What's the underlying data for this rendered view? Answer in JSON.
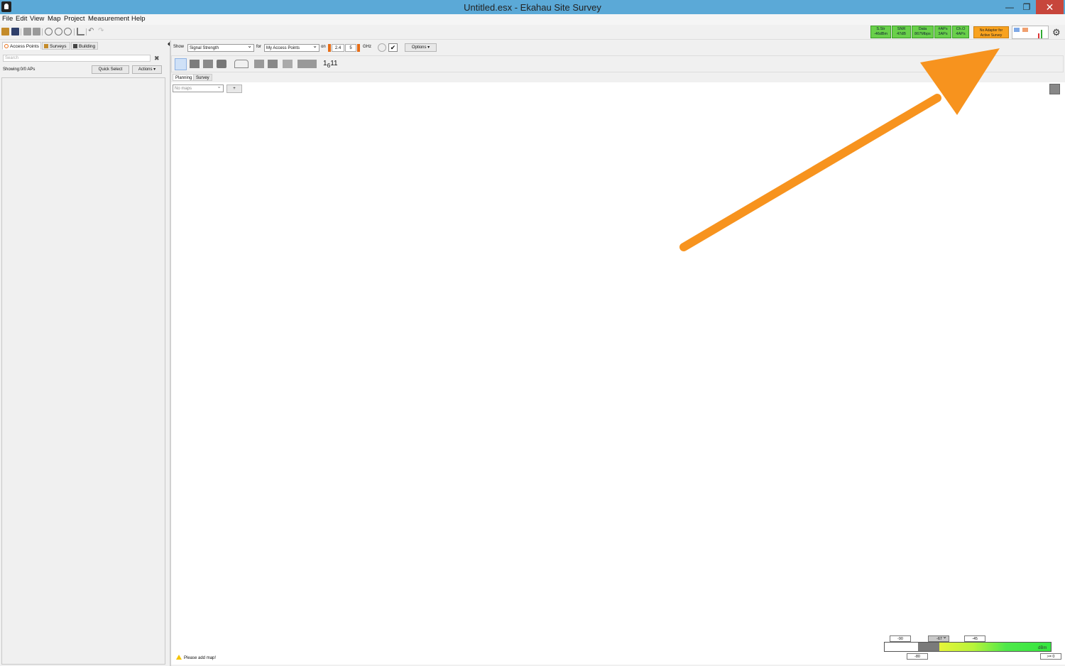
{
  "window": {
    "title": "Untitled.esx - Ekahau Site Survey"
  },
  "menu": [
    "File",
    "Edit",
    "View",
    "Map",
    "Project",
    "Measurement",
    "Help"
  ],
  "status_boxes": [
    {
      "line1": "S.Str",
      "line2": "-46dBm"
    },
    {
      "line1": "SNR",
      "line2": "47dB"
    },
    {
      "line1": "Data",
      "line2": "867Mbps"
    },
    {
      "line1": "#APs",
      "line2": "3APs"
    },
    {
      "line1": "Ch.O",
      "line2": "4APs"
    }
  ],
  "adapter": {
    "line1": "No Adapter for",
    "line2": "Active Survey"
  },
  "left": {
    "tabs": [
      "Access Points",
      "Surveys",
      "Building"
    ],
    "search_placeholder": "Search",
    "showing": "Showing:0/0 APs",
    "quick_select": "Quick Select",
    "actions": "Actions ▾"
  },
  "main": {
    "show_label": "Show",
    "show_value": "Signal Strength",
    "for_label": "for",
    "for_value": "My Access Points",
    "on_label": "on",
    "band1": "2.4",
    "band2": "5",
    "ghz": "GHz",
    "options": "Options ▾",
    "subtabs": [
      "Planning",
      "Survey"
    ],
    "maps_placeholder": "No maps",
    "add_map": "+",
    "please": "Please add map!"
  },
  "legend": {
    "top_tags": [
      "-90",
      "-67",
      "-45"
    ],
    "bottom_tags": [
      "-80",
      ">= 0"
    ],
    "unit": "dBm"
  },
  "colors": {
    "titlebar": "#5ba9d7",
    "status_green": "#69d04a",
    "adapter_orange": "#f8a21f",
    "arrow": "#f7931e"
  }
}
